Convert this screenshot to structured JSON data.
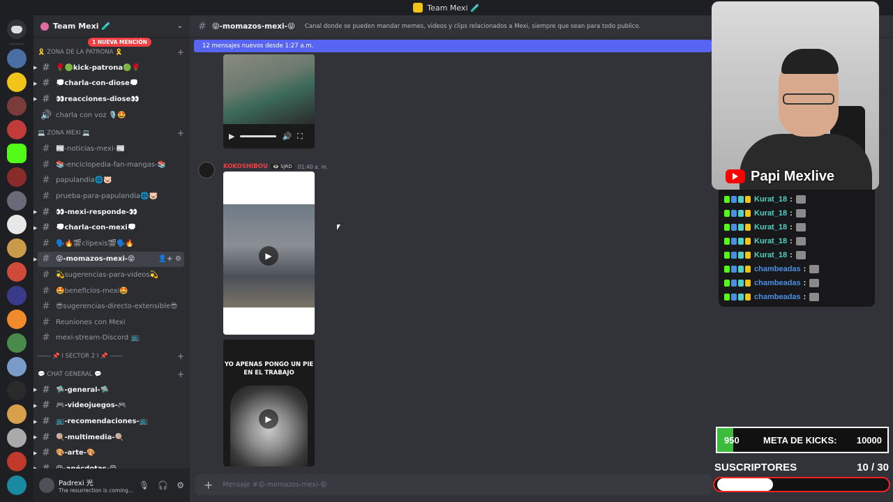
{
  "window": {
    "title": "Team Mexi 🧪"
  },
  "guild": {
    "name": "Team Mexi 🧪"
  },
  "sidebar": {
    "categories": [
      {
        "label": "🎗️ Zona de la Patrona 🎗️",
        "badge": "1 NUEVA MENCIÓN",
        "channels": [
          {
            "label": "🌹🟢kick-patrona🟢🌹",
            "unread": true
          },
          {
            "label": "💭charla-con-diose💭",
            "unread": true
          },
          {
            "label": "👀reacciones-diose👀",
            "unread": true
          },
          {
            "label": "charla con voz 🎙️🤩",
            "unread": false,
            "voice": true
          }
        ]
      },
      {
        "label": "💻 ZONA MEXI 💻",
        "channels": [
          {
            "label": "📰-noticias-mexi-📰",
            "unread": false
          },
          {
            "label": "📚-enciclopedia-fan-mangas-📚",
            "unread": false
          },
          {
            "label": "papulandia🌐🐷",
            "unread": false
          },
          {
            "label": "prueba-para-papulandia🌐🐷",
            "unread": false
          },
          {
            "label": "👀-mexi-responde-👀",
            "unread": true
          },
          {
            "label": "💭charla-con-mexi💭",
            "unread": true
          },
          {
            "label": "🗣️🔥🎬clipexis🎬🗣️🔥",
            "unread": false
          },
          {
            "label": "😝-momazos-mexi-😝",
            "unread": true,
            "active": true
          },
          {
            "label": "💫sugerencias-para-videos💫",
            "unread": false
          },
          {
            "label": "🤩beneficios-mexi🤩",
            "unread": false
          },
          {
            "label": "😎sugerencias-directo-extensible😎",
            "unread": false
          },
          {
            "label": "Reuniones con Mexi",
            "unread": false
          },
          {
            "label": "mexi-stream-Discord 📺",
            "unread": false
          }
        ]
      },
      {
        "label": "------ 📌 I SECTOR 2 I 📌 ------",
        "channels": []
      },
      {
        "label": "💬 CHAT GENERAL 💬",
        "channels": [
          {
            "label": "🛸-general-🛸",
            "unread": true
          },
          {
            "label": "🎮-videojuegos-🎮",
            "unread": true
          },
          {
            "label": "📺-recomendaciones-📺",
            "unread": true
          },
          {
            "label": "🍭-multimedia-🍭",
            "unread": true
          },
          {
            "label": "🎨-arte-🎨",
            "unread": true
          },
          {
            "label": "😝-anécdotas-😝",
            "unread": true
          }
        ]
      }
    ]
  },
  "user": {
    "name": "Padrexi 光",
    "status": "The resurrection is coming..."
  },
  "channel": {
    "title": "😝-momazos-mexi-😝",
    "topic": "Canal donde se pueden mandar memes, videos y clips relacionados a Mexi, siempre que sean para todo publico.",
    "new_messages_banner": "12 mensajes nuevos desde 1:27 a.m."
  },
  "messages": [
    {
      "author": "KOKOSHIBOU",
      "tag": "👁️ SJRD",
      "time": "01:40 a. m.",
      "caption": "YO APENAS PONGO UN PIE EN EL TRABAJO"
    }
  ],
  "composer": {
    "placeholder": "Mensaje #😝-momazos-mexi-😝"
  },
  "overlay": {
    "streamer": "Papi Mexlive",
    "chat": [
      {
        "name": "Kurat_18",
        "color": "#4fd1c5"
      },
      {
        "name": "Kurat_18",
        "color": "#4fd1c5"
      },
      {
        "name": "Kurat_18",
        "color": "#4fd1c5"
      },
      {
        "name": "Kurat_18",
        "color": "#4fd1c5"
      },
      {
        "name": "Kurat_18",
        "color": "#4fd1c5"
      },
      {
        "name": "chambeadas",
        "color": "#4a90e2"
      },
      {
        "name": "chambeadas",
        "color": "#4a90e2"
      },
      {
        "name": "chambeadas",
        "color": "#4a90e2"
      }
    ],
    "kick_goal": {
      "current": "950",
      "label": "META DE KICKS:",
      "target": "10000",
      "fraction": 0.095
    },
    "subs": {
      "label": "SUSCRIPTORES",
      "count": "10 / 30",
      "fraction": 0.333
    }
  },
  "colors": {
    "accent": "#5865f2",
    "kick_green": "#3dbb3d",
    "mention_red": "#f23f43"
  }
}
